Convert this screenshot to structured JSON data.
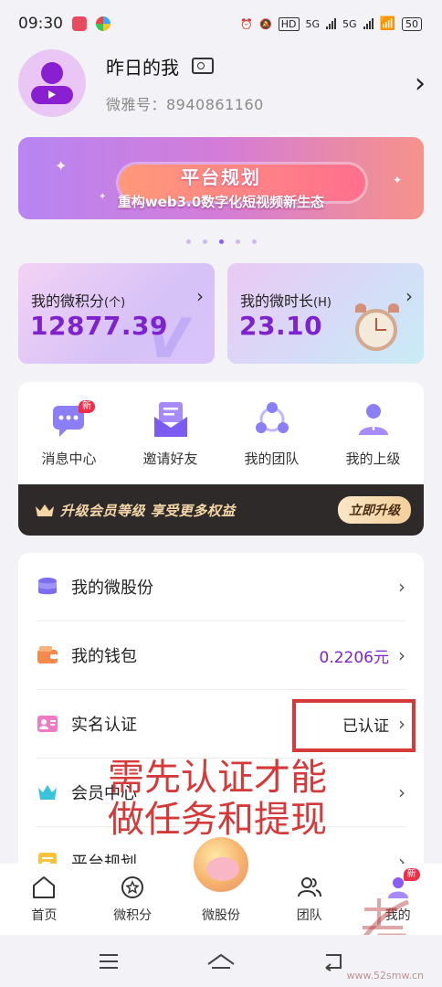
{
  "status_bar": {
    "time": "09:30",
    "hd_label": "HD",
    "net1": "5G",
    "net2": "5G",
    "battery": "50"
  },
  "profile": {
    "nickname": "昨日的我",
    "weiya_id": "微雅号：8940861160"
  },
  "banner": {
    "title": "平台规划",
    "subtitle": "重构web3.0数字化短视频新生态",
    "page_count": 5,
    "active_index": 2
  },
  "stats": {
    "points_label": "我的微积分",
    "points_unit": "(个)",
    "points_value": "12877.39",
    "duration_label": "我的微时长",
    "duration_unit": "(H)",
    "duration_value": "23.10"
  },
  "quick_actions": [
    {
      "label": "消息中心",
      "icon": "message-center-icon",
      "badge": "新"
    },
    {
      "label": "邀请好友",
      "icon": "invite-friends-icon"
    },
    {
      "label": "我的团队",
      "icon": "my-team-icon"
    },
    {
      "label": "我的上级",
      "icon": "my-superior-icon"
    }
  ],
  "vip_bar": {
    "text": "升级会员等级  享受更多权益",
    "button": "立即升级"
  },
  "menu": [
    {
      "label": "我的微股份",
      "value": "",
      "icon": "shares-icon"
    },
    {
      "label": "我的钱包",
      "value": "0.2206元",
      "icon": "wallet-icon"
    },
    {
      "label": "实名认证",
      "value": "已认证",
      "icon": "real-name-icon"
    },
    {
      "label": "会员中心",
      "value": "",
      "icon": "member-center-icon"
    },
    {
      "label": "平台规划",
      "value": "",
      "icon": "platform-plan-icon"
    }
  ],
  "annotation": {
    "line1": "需先认证才能",
    "line2": "做任务和提现"
  },
  "tabbar": [
    {
      "label": "首页",
      "icon": "home-icon"
    },
    {
      "label": "微积分",
      "icon": "points-icon"
    },
    {
      "label": "微股份",
      "icon": "shares-center-icon"
    },
    {
      "label": "团队",
      "icon": "team-icon"
    },
    {
      "label": "我的",
      "icon": "me-icon",
      "badge": "新"
    }
  ],
  "watermark": "www.52smw.cn",
  "colors": {
    "accent_purple": "#7e22ce",
    "annotation_red": "#d43a3a",
    "vip_bar_bg": "#2f2a2a"
  }
}
